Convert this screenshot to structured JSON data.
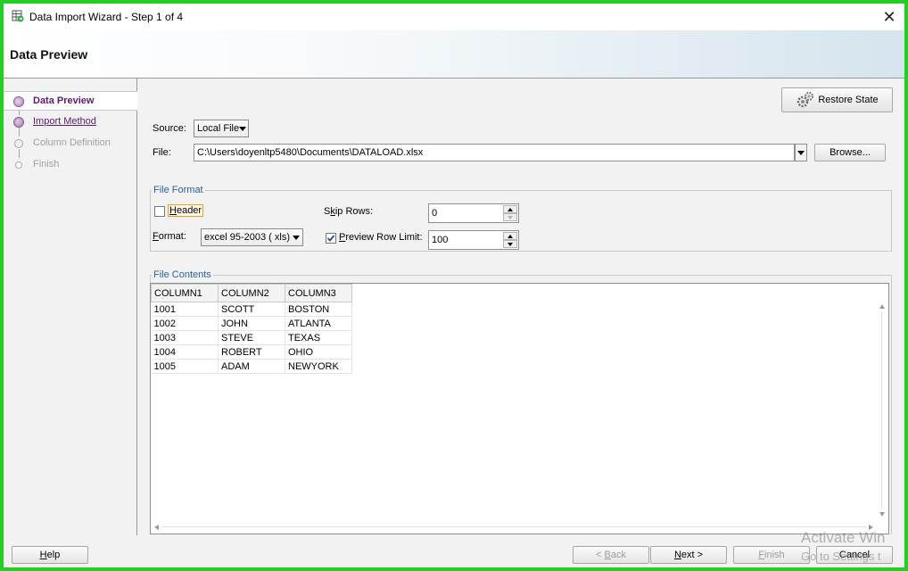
{
  "window": {
    "title": "Data Import Wizard - Step 1 of 4",
    "close_glyph": "✕"
  },
  "banner": {
    "title": "Data Preview"
  },
  "nav": {
    "items": [
      {
        "label": "Data Preview",
        "state": "active"
      },
      {
        "label": "Import Method",
        "state": "link"
      },
      {
        "label": "Column Definition",
        "state": "disabled"
      },
      {
        "label": "Finish",
        "state": "disabled"
      }
    ]
  },
  "toolbar": {
    "restore_state_label": "Restore State"
  },
  "source": {
    "label": "Source:",
    "value": "Local File"
  },
  "file": {
    "label": "File:",
    "value": "C:\\Users\\doyenltp5480\\Documents\\DATALOAD.xlsx",
    "browse_label": "Browse..."
  },
  "file_format": {
    "title": "File Format",
    "header_label": "Header",
    "header_checked": false,
    "format_label": "Format:",
    "format_value": "excel 95-2003 ( xls)",
    "skip_rows_label": "Skip Rows:",
    "skip_rows_value": "0",
    "preview_limit_label": "Preview Row Limit:",
    "preview_limit_checked": true,
    "preview_limit_value": "100"
  },
  "file_contents": {
    "title": "File Contents",
    "columns": [
      "COLUMN1",
      "COLUMN2",
      "COLUMN3"
    ],
    "rows": [
      [
        "1001",
        "SCOTT",
        "BOSTON"
      ],
      [
        "1002",
        "JOHN",
        "ATLANTA"
      ],
      [
        "1003",
        "STEVE",
        "TEXAS"
      ],
      [
        "1004",
        "ROBERT",
        "OHIO"
      ],
      [
        "1005",
        "ADAM",
        "NEWYORK"
      ]
    ]
  },
  "footer": {
    "help_label": "Help",
    "back_label": "< Back",
    "next_label": "Next >",
    "finish_label": "Finish",
    "cancel_label": "Cancel"
  },
  "watermark": {
    "line1": "Activate Win",
    "line2": "Go to Settings t"
  },
  "colors": {
    "frame_border": "#21d021",
    "nav_active_text": "#5a1a6e",
    "group_title": "#2a5ea0"
  },
  "icons": {
    "app": "database-import-icon",
    "restore": "gears-icon"
  }
}
